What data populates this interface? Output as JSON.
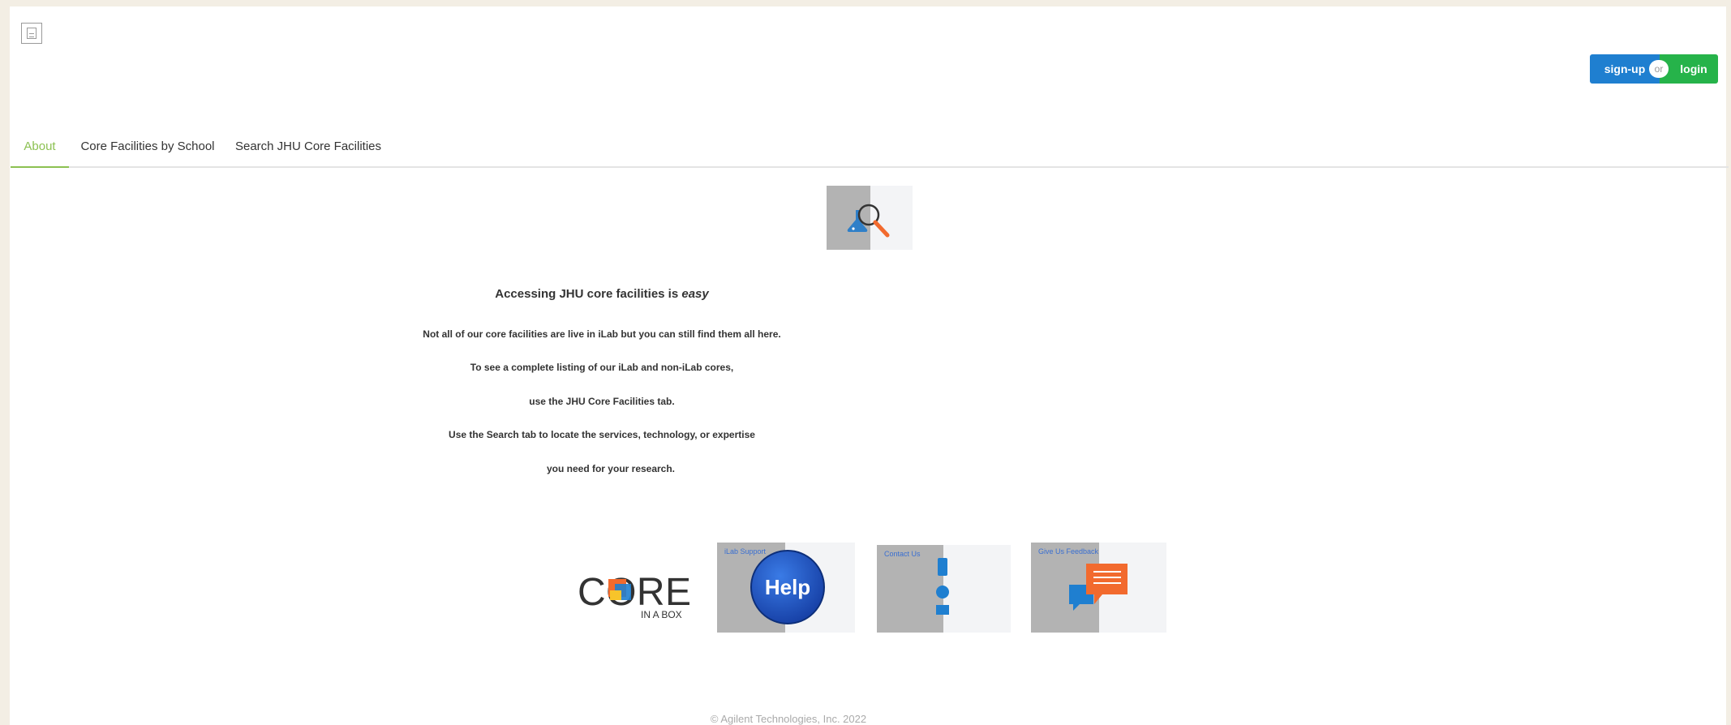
{
  "header": {
    "logo_icon": "broken-image-icon",
    "auth": {
      "signup_label": "sign-up",
      "or_label": "or",
      "login_label": "login"
    }
  },
  "tabs": [
    {
      "label": "About",
      "active": true
    },
    {
      "label": "Core Facilities by School",
      "active": false
    },
    {
      "label": "Search JHU Core Facilities",
      "active": false
    }
  ],
  "about": {
    "hero_icon": "flask-magnifier-icon",
    "headline_prefix": "Accessing JHU core facilities is",
    "headline_emphasis": "easy",
    "lines": [
      "Not all of our core facilities are live in iLab but you can still find them all here.",
      "To see a complete listing of our iLab and non-iLab cores,",
      "use the JHU Core Facilities tab.",
      "Use the Search tab to locate the services, technology, or expertise",
      "you need for your research."
    ]
  },
  "links": {
    "core_in_a_box": {
      "logo_text": "CORE",
      "sub_text": "IN A BOX"
    },
    "ilab_support": {
      "title": "iLab Support",
      "badge": "Help"
    },
    "contact_us": {
      "title": "Contact Us"
    },
    "feedback": {
      "title": "Give Us Feedback"
    }
  },
  "footer": {
    "copyright": "© Agilent Technologies, Inc. 2022"
  },
  "colors": {
    "accent_green": "#8cc152",
    "signup_blue": "#1f7fd0",
    "login_green": "#26b34a",
    "link_blue": "#3a6fd1"
  }
}
